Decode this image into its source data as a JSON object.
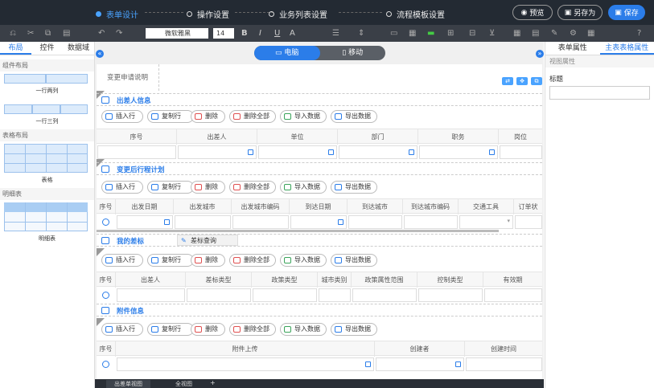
{
  "steps": [
    {
      "label": "表单设计"
    },
    {
      "label": "操作设置"
    },
    {
      "label": "业务列表设置"
    },
    {
      "label": "流程模板设置"
    }
  ],
  "top_buttons": {
    "preview": "预览",
    "save_as": "另存为",
    "save": "保存"
  },
  "toolbar": {
    "font": "微软雅黑",
    "size": "14",
    "bold": "B",
    "italic": "I",
    "underline": "U",
    "font_color": "A"
  },
  "left_tabs": [
    "布局",
    "控件",
    "数据域"
  ],
  "left_sections": {
    "component": "组件布局",
    "table": "表格布局",
    "detail": "明细表"
  },
  "components": {
    "two_col": "一行两列",
    "three_col": "一行三列",
    "table": "表格",
    "detail": "明细表"
  },
  "device_tabs": {
    "pc": "电脑",
    "mobile": "移动"
  },
  "form_title": "变更申请说明",
  "action_buttons": [
    "插入行",
    "复制行",
    "删除",
    "删除全部",
    "导入数据",
    "导出数据"
  ],
  "sections": [
    {
      "title": "出差人信息",
      "columns": [
        "序号",
        "出差人",
        "单位",
        "部门",
        "职务",
        "岗位"
      ]
    },
    {
      "title": "变更后行程计划",
      "columns": [
        "序号",
        "出发日期",
        "出发城市",
        "出发城市编码",
        "到达日期",
        "到达城市",
        "到达城市编码",
        "交通工具",
        "订单状"
      ]
    },
    {
      "title": "我的差标",
      "extra_button": "差标查询",
      "columns": [
        "序号",
        "出差人",
        "差标类型",
        "政策类型",
        "城市类别",
        "政策属性范围",
        "控制类型",
        "有效期"
      ]
    },
    {
      "title": "附件信息",
      "columns": [
        "序号",
        "附件上传",
        "创建者",
        "创建时间"
      ]
    }
  ],
  "right_tabs": [
    "表单属性",
    "主表表格属性"
  ],
  "right_section": "视图属性",
  "right_field_label": "标题",
  "right_field_value": "",
  "bottom_tabs": [
    "出差单视图",
    "全视图",
    "+"
  ]
}
